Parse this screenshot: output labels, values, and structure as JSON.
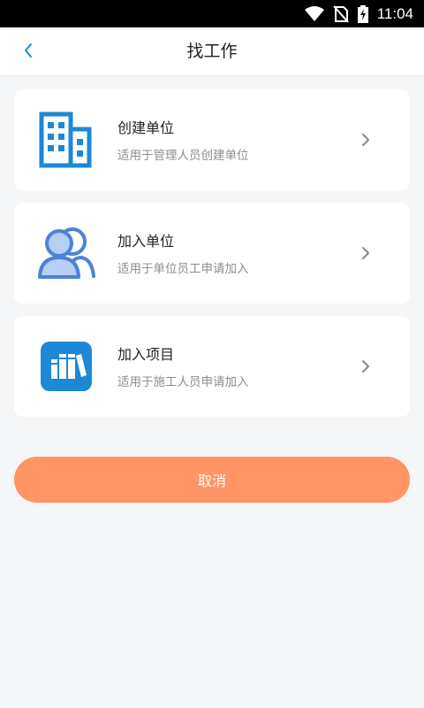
{
  "status_bar": {
    "time": "11:04",
    "icons": [
      "wifi-icon",
      "no-sim-icon",
      "battery-charging-icon"
    ]
  },
  "nav": {
    "title": "找工作",
    "back_icon": "back-chevron-icon"
  },
  "cards": [
    {
      "title": "创建单位",
      "desc": "适用于管理人员创建单位",
      "icon": "building-icon"
    },
    {
      "title": "加入单位",
      "desc": "适用于单位员工申请加入",
      "icon": "users-icon"
    },
    {
      "title": "加入项目",
      "desc": "适用于施工人员申请加入",
      "icon": "books-icon"
    }
  ],
  "cancel_label": "取消",
  "colors": {
    "accent_blue": "#1e88d4",
    "button_orange": "#ff9464",
    "background": "#f5f6f8"
  }
}
